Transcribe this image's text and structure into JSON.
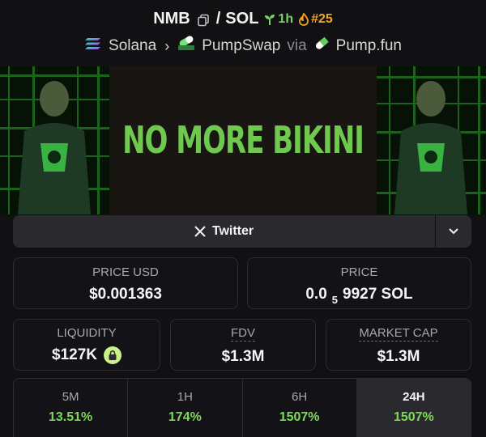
{
  "header": {
    "token": "NMB",
    "quote": "SOL",
    "age": "1h",
    "rank": "#25",
    "chain": "Solana",
    "dex": "PumpSwap",
    "via_label": "via",
    "launchpad": "Pump.fun"
  },
  "banner": {
    "text": "NO MORE BIKINI"
  },
  "socials": {
    "twitter_label": "Twitter"
  },
  "prices": {
    "price_usd_label": "PRICE USD",
    "price_usd_value": "$0.001363",
    "price_label": "PRICE",
    "price_prefix": "0.0",
    "price_sub": "5",
    "price_suffix": "9927 SOL"
  },
  "stats": {
    "liquidity_label": "LIQUIDITY",
    "liquidity_value": "$127K",
    "fdv_label": "FDV",
    "fdv_value": "$1.3M",
    "mcap_label": "MARKET CAP",
    "mcap_value": "$1.3M"
  },
  "changes": [
    {
      "label": "5M",
      "value": "13.51%"
    },
    {
      "label": "1H",
      "value": "174%"
    },
    {
      "label": "6H",
      "value": "1507%"
    },
    {
      "label": "24H",
      "value": "1507%"
    }
  ],
  "colors": {
    "accent_green": "#7ed957",
    "rank_orange": "#f5a524",
    "background": "#111114"
  },
  "icons": [
    "copy-icon",
    "seedling-icon",
    "flame-icon",
    "solana-icon",
    "pumpswap-icon",
    "pill-icon",
    "x-logo-icon",
    "chevron-down-icon",
    "lock-icon"
  ]
}
